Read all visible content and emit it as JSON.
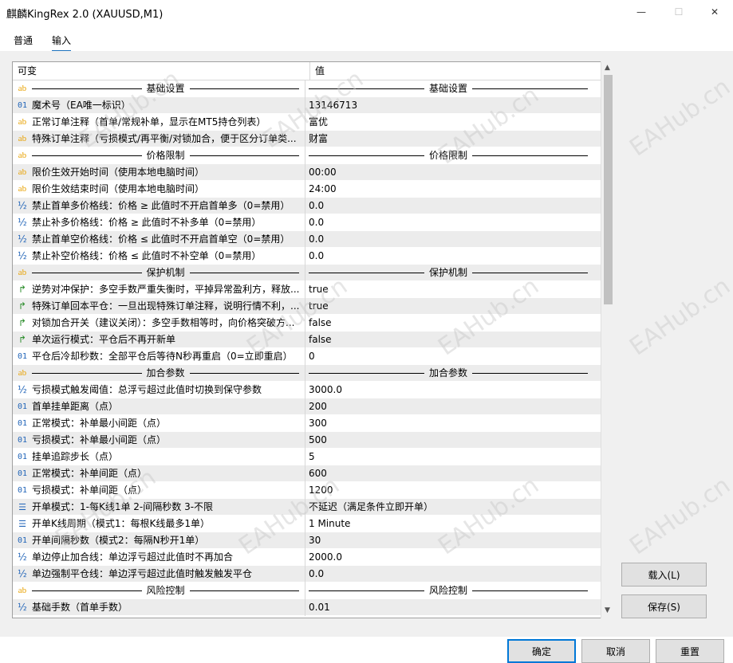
{
  "window": {
    "title": "麒麟KingRex 2.0 (XAUUSD,M1)",
    "min_icon": "—",
    "max_icon": "☐",
    "close_icon": "✕"
  },
  "tabs": [
    {
      "label": "普通"
    },
    {
      "label": "输入"
    }
  ],
  "grid": {
    "col_variable": "可变",
    "col_value": "值",
    "rows": [
      {
        "type": "sep",
        "icon": "ab",
        "label": "基础设置",
        "value": "基础设置"
      },
      {
        "type": "int",
        "icon": "01",
        "label": "魔术号（EA唯一标识）",
        "value": "13146713"
      },
      {
        "type": "str",
        "icon": "ab",
        "label": "正常订单注释（首单/常规补单，显示在MT5持仓列表）",
        "value": "富优"
      },
      {
        "type": "str",
        "icon": "ab",
        "label": "特殊订单注释（亏损模式/再平衡/对锁加合，便于区分订单类...",
        "value": "财富"
      },
      {
        "type": "sep",
        "icon": "ab",
        "label": "价格限制",
        "value": "价格限制"
      },
      {
        "type": "str",
        "icon": "ab",
        "label": "限价生效开始时间（使用本地电脑时间）",
        "value": "00:00"
      },
      {
        "type": "str",
        "icon": "ab",
        "label": "限价生效结束时间（使用本地电脑时间）",
        "value": "24:00"
      },
      {
        "type": "dbl",
        "icon": "½",
        "label": "禁止首单多价格线：价格 ≥ 此值时不开启首单多（0=禁用）",
        "value": "0.0"
      },
      {
        "type": "dbl",
        "icon": "½",
        "label": "禁止补多价格线：价格 ≥ 此值时不补多单（0=禁用）",
        "value": "0.0"
      },
      {
        "type": "dbl",
        "icon": "½",
        "label": "禁止首单空价格线：价格 ≤ 此值时不开启首单空（0=禁用）",
        "value": "0.0"
      },
      {
        "type": "dbl",
        "icon": "½",
        "label": "禁止补空价格线：价格 ≤ 此值时不补空单（0=禁用）",
        "value": "0.0"
      },
      {
        "type": "sep",
        "icon": "ab",
        "label": "保护机制",
        "value": "保护机制"
      },
      {
        "type": "bool",
        "icon": "↱",
        "label": "逆势对冲保护：多空手数严重失衡时，平掉异常盈利方，释放...",
        "value": "true"
      },
      {
        "type": "bool",
        "icon": "↱",
        "label": "特殊订单回本平仓：一旦出现特殊订单注释，说明行情不利，...",
        "value": "true"
      },
      {
        "type": "bool",
        "icon": "↱",
        "label": "对锁加合开关（建议关闭）：多空手数相等时，向价格突破方...",
        "value": "false"
      },
      {
        "type": "bool",
        "icon": "↱",
        "label": "单次运行模式：平仓后不再开新单",
        "value": "false"
      },
      {
        "type": "int",
        "icon": "01",
        "label": "平仓后冷却秒数：全部平仓后等待N秒再重启（0=立即重启）",
        "value": "0"
      },
      {
        "type": "sep",
        "icon": "ab",
        "label": "加合参数",
        "value": "加合参数"
      },
      {
        "type": "dbl",
        "icon": "½",
        "label": "亏损模式触发阈值：总浮亏超过此值时切换到保守参数",
        "value": "3000.0"
      },
      {
        "type": "int",
        "icon": "01",
        "label": "首单挂单距离（点）",
        "value": "200"
      },
      {
        "type": "int",
        "icon": "01",
        "label": "正常模式：补单最小间距（点）",
        "value": "300"
      },
      {
        "type": "int",
        "icon": "01",
        "label": "亏损模式：补单最小间距（点）",
        "value": "500"
      },
      {
        "type": "int",
        "icon": "01",
        "label": "挂单追踪步长（点）",
        "value": "5"
      },
      {
        "type": "int",
        "icon": "01",
        "label": "正常模式：补单间距（点）",
        "value": "600"
      },
      {
        "type": "int",
        "icon": "01",
        "label": "亏损模式：补单间距（点）",
        "value": "1200"
      },
      {
        "type": "enum",
        "icon": "☰",
        "label": "开单模式：1-每K线1单 2-间隔秒数 3-不限",
        "value": "不延迟（满足条件立即开单）"
      },
      {
        "type": "enum",
        "icon": "☰",
        "label": "开单K线周期（模式1：每根K线最多1单）",
        "value": "1 Minute"
      },
      {
        "type": "int",
        "icon": "01",
        "label": "开单间隔秒数（模式2：每隔N秒开1单）",
        "value": "30"
      },
      {
        "type": "dbl",
        "icon": "½",
        "label": "单边停止加合线：单边浮亏超过此值时不再加合",
        "value": "2000.0"
      },
      {
        "type": "dbl",
        "icon": "½",
        "label": "单边强制平仓线：单边浮亏超过此值时触发触发平仓",
        "value": "0.0"
      },
      {
        "type": "sep",
        "icon": "ab",
        "label": "风险控制",
        "value": "风险控制"
      },
      {
        "type": "dbl",
        "icon": "½",
        "label": "基础手数（首单手数）",
        "value": "0.01"
      }
    ]
  },
  "buttons": {
    "load": "载入(L)",
    "save": "保存(S)",
    "ok": "确定",
    "cancel": "取消",
    "reset": "重置"
  },
  "scrollbar": {
    "up_icon": "▲",
    "down_icon": "▼"
  },
  "watermark": "EAHub.cn"
}
